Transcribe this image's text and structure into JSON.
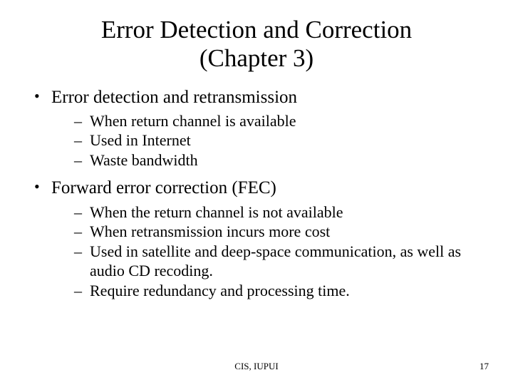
{
  "title_line1": "Error Detection and Correction",
  "title_line2": "(Chapter 3)",
  "bullets": [
    {
      "text": "Error detection and retransmission",
      "sub": [
        "When return channel is available",
        "Used in Internet",
        "Waste bandwidth"
      ]
    },
    {
      "text": "Forward error correction (FEC)",
      "sub": [
        "When the return channel is not available",
        "When retransmission incurs more cost",
        "Used in satellite and deep-space communication, as well as audio CD recoding.",
        "Require redundancy and processing time."
      ]
    }
  ],
  "footer_center": "CIS, IUPUI",
  "page_number": "17"
}
